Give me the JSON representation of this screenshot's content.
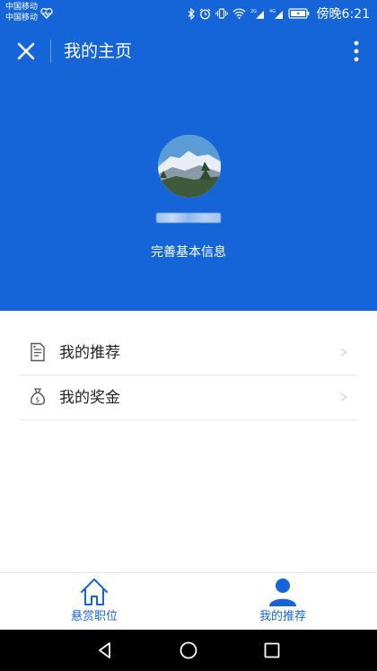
{
  "status_bar": {
    "carrier_1": "中国移动",
    "carrier_2": "中国移动",
    "time": "傍晚6:21",
    "icons": [
      "heart-pulse-icon",
      "bluetooth-icon",
      "alarm-icon",
      "vibrate-icon",
      "wifi-icon",
      "signal-2g-icon",
      "signal-4g-icon",
      "battery-charging-icon"
    ]
  },
  "header": {
    "title": "我的主页",
    "close_icon": "close-icon",
    "more_icon": "more-vertical-icon",
    "complete_info_label": "完善基本信息",
    "background_color": "#1565d8"
  },
  "menu": {
    "items": [
      {
        "label": "我的推荐",
        "icon": "document-list-icon"
      },
      {
        "label": "我的奖金",
        "icon": "money-bag-icon"
      }
    ]
  },
  "tabbar": {
    "tabs": [
      {
        "label": "悬赏职位",
        "icon": "home-icon"
      },
      {
        "label": "我的推荐",
        "icon": "person-icon",
        "active": true
      }
    ],
    "accent_color": "#1565d8"
  },
  "navbar": {
    "buttons": [
      "back-triangle-icon",
      "home-circle-icon",
      "recent-square-icon"
    ]
  }
}
